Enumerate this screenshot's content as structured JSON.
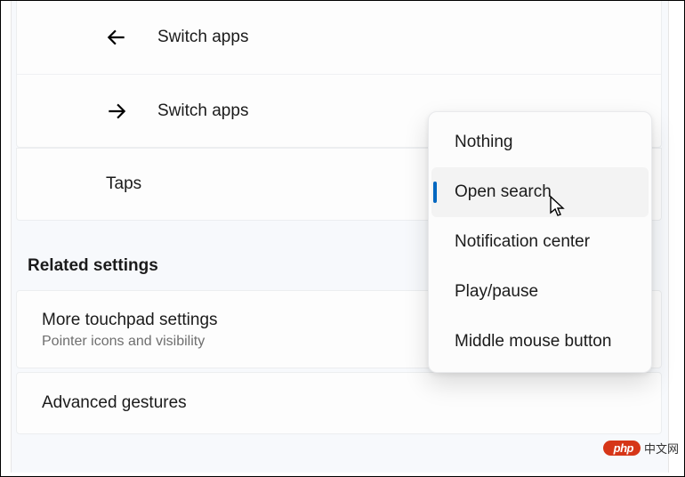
{
  "gestures": {
    "back": {
      "label": "Switch apps"
    },
    "forward": {
      "label": "Switch apps"
    }
  },
  "taps": {
    "label": "Taps"
  },
  "related": {
    "header": "Related settings",
    "more": {
      "title": "More touchpad settings",
      "subtitle": "Pointer icons and visibility"
    },
    "advanced": {
      "title": "Advanced gestures"
    }
  },
  "popup": {
    "items": [
      {
        "label": "Nothing"
      },
      {
        "label": "Open search"
      },
      {
        "label": "Notification center"
      },
      {
        "label": "Play/pause"
      },
      {
        "label": "Middle mouse button"
      }
    ],
    "selected_index": 1
  },
  "watermark": {
    "badge": "php",
    "text": "中文网"
  }
}
